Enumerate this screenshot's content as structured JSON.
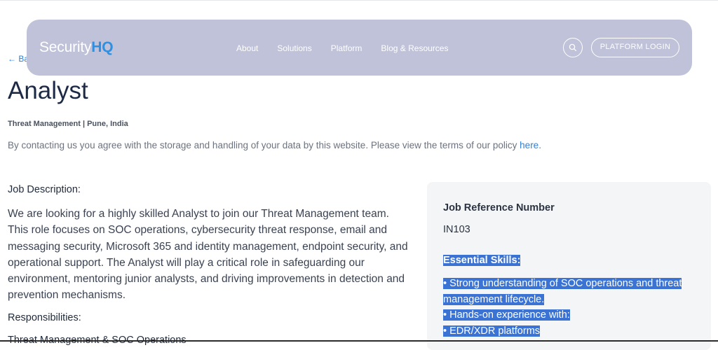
{
  "header": {
    "logo_main": "Security",
    "logo_accent": "HQ",
    "nav": [
      "About",
      "Solutions",
      "Platform",
      "Blog & Resources"
    ],
    "login_label": "PLATFORM LOGIN",
    "back_label": "← Ba"
  },
  "page": {
    "title": "Analyst",
    "subtitle": "Threat Management | Pune, India",
    "consent_text": "By contacting us you agree with the storage and handling of your data by this website. Please view the terms of our policy ",
    "consent_link": "here.",
    "job_description_heading": "Job Description:",
    "job_description": "We are looking for a highly skilled Analyst to join our Threat Management team. This role focuses on SOC operations, cybersecurity threat response, email and messaging security, Microsoft 365 and identity management, endpoint security, and operational support. The Analyst will play a critical role in safeguarding our environment, mentoring junior analysts, and driving improvements in detection and prevention mechanisms.",
    "responsibilities_heading": "Responsibilities:",
    "cutoff_text": "Threat Management & SOC Operations"
  },
  "sidebar": {
    "ref_label": "Job Reference Number",
    "ref_value": "IN103",
    "skills_heading": "Essential Skills:",
    "skills": [
      "• Strong understanding of SOC operations and threat",
      "management lifecycle.",
      "• Hands-on experience with:",
      "• EDR/XDR platforms"
    ]
  },
  "colors": {
    "accent": "#2f8fe0",
    "selection": "#3a73d4",
    "navbar": "#bfc2d8"
  }
}
